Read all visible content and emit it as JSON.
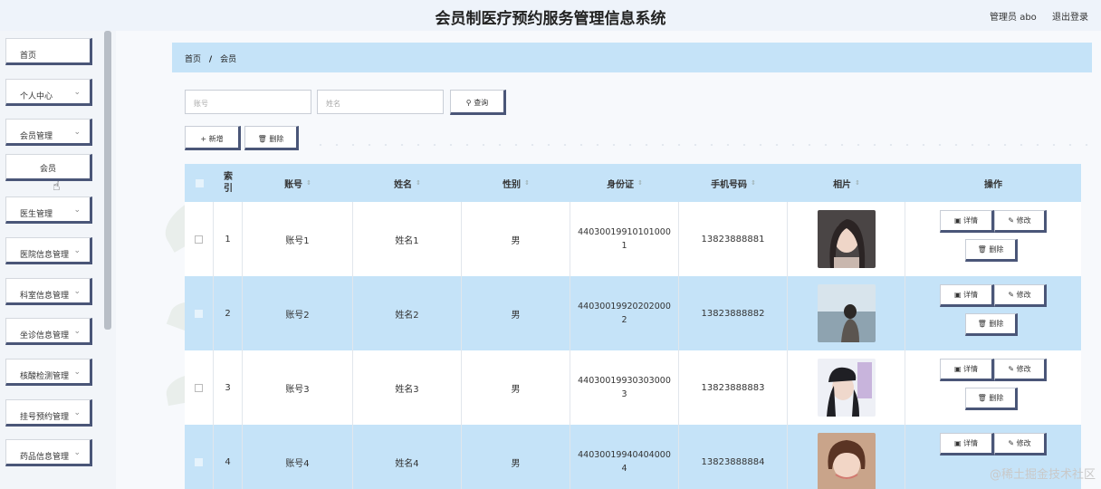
{
  "header": {
    "title": "会员制医疗预约服务管理信息系统",
    "user": "管理员 abo",
    "logout": "退出登录"
  },
  "sidebar": {
    "items": [
      {
        "label": "首页"
      },
      {
        "label": "个人中心"
      },
      {
        "label": "会员管理"
      },
      {
        "label": "会员"
      },
      {
        "label": "医生管理"
      },
      {
        "label": "医院信息管理"
      },
      {
        "label": "科室信息管理"
      },
      {
        "label": "坐诊信息管理"
      },
      {
        "label": "核酸检测管理"
      },
      {
        "label": "挂号预约管理"
      },
      {
        "label": "药品信息管理"
      }
    ],
    "chevron": "chevron-down-icon"
  },
  "breadcrumb": {
    "home": "首页",
    "separator": "/",
    "current": "会员"
  },
  "search": {
    "account_placeholder": "账号",
    "name_placeholder": "姓名",
    "search_button": "查询",
    "search_icon": "search-icon"
  },
  "actions": {
    "add_label": "新增",
    "delete_label": "删除"
  },
  "table": {
    "headers": {
      "index": "索引",
      "account": "账号",
      "name": "姓名",
      "gender": "性别",
      "id_card": "身份证",
      "phone": "手机号码",
      "photo": "相片",
      "operation": "操作"
    },
    "sort_icon": "sort-icon",
    "rows": [
      {
        "index": "1",
        "account": "账号1",
        "name": "姓名1",
        "gender": "男",
        "id_card_line1": "44030019910101000",
        "id_card_line2": "1",
        "phone": "13823888881"
      },
      {
        "index": "2",
        "account": "账号2",
        "name": "姓名2",
        "gender": "男",
        "id_card_line1": "44030019920202000",
        "id_card_line2": "2",
        "phone": "13823888882"
      },
      {
        "index": "3",
        "account": "账号3",
        "name": "姓名3",
        "gender": "男",
        "id_card_line1": "44030019930303000",
        "id_card_line2": "3",
        "phone": "13823888883"
      },
      {
        "index": "4",
        "account": "账号4",
        "name": "姓名4",
        "gender": "男",
        "id_card_line1": "44030019940404000",
        "id_card_line2": "4",
        "phone": "13823888884"
      }
    ],
    "row_actions": {
      "detail": "详情",
      "edit": "修改",
      "delete": "删除"
    }
  },
  "watermark": "@稀土掘金技术社区",
  "colors": {
    "header_blue": "#c5e3f8",
    "button_shadow": "#4a5678",
    "background": "#f4f7fb"
  }
}
